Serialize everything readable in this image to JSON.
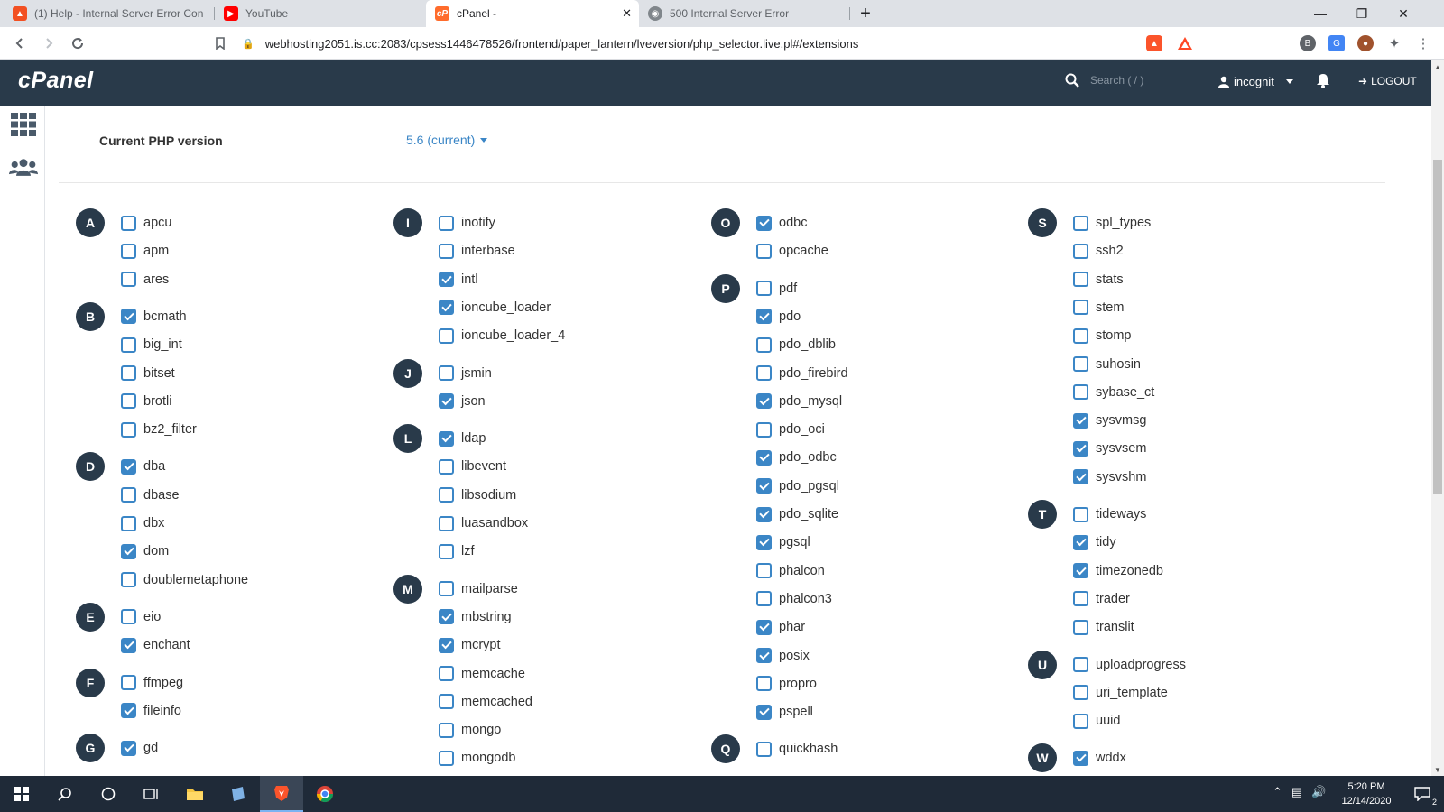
{
  "browser": {
    "tabs": [
      {
        "label": "(1) Help - Internal Server Error Conne",
        "icon": "brave-lion-icon",
        "active": false
      },
      {
        "label": "YouTube",
        "icon": "youtube-icon",
        "active": false
      },
      {
        "label": "cPanel -",
        "icon": "cpanel-icon",
        "active": true
      },
      {
        "label": "500 Internal Server Error",
        "icon": "globe-icon",
        "active": false
      }
    ],
    "new_tab_label": "+",
    "url": "webhosting2051.is.cc:2083/cpsess1446478526/frontend/paper_lantern/lveversion/php_selector.live.pl#/extensions"
  },
  "cpanel": {
    "logo": "cPanel",
    "search_placeholder": "Search ( / )",
    "user": "incognit",
    "logout": "LOGOUT",
    "brand_color": "#293a4a",
    "accent_color": "#3b86c6"
  },
  "php": {
    "label": "Current PHP version",
    "version": "5.6 (current)"
  },
  "extension_columns": [
    [
      {
        "letter": "A",
        "items": [
          {
            "name": "apcu",
            "checked": false
          },
          {
            "name": "apm",
            "checked": false
          },
          {
            "name": "ares",
            "checked": false
          }
        ]
      },
      {
        "letter": "B",
        "items": [
          {
            "name": "bcmath",
            "checked": true
          },
          {
            "name": "big_int",
            "checked": false
          },
          {
            "name": "bitset",
            "checked": false
          },
          {
            "name": "brotli",
            "checked": false
          },
          {
            "name": "bz2_filter",
            "checked": false
          }
        ]
      },
      {
        "letter": "D",
        "items": [
          {
            "name": "dba",
            "checked": true
          },
          {
            "name": "dbase",
            "checked": false
          },
          {
            "name": "dbx",
            "checked": false
          },
          {
            "name": "dom",
            "checked": true
          },
          {
            "name": "doublemetaphone",
            "checked": false
          }
        ]
      },
      {
        "letter": "E",
        "items": [
          {
            "name": "eio",
            "checked": false
          },
          {
            "name": "enchant",
            "checked": true
          }
        ]
      },
      {
        "letter": "F",
        "items": [
          {
            "name": "ffmpeg",
            "checked": false
          },
          {
            "name": "fileinfo",
            "checked": true
          }
        ]
      },
      {
        "letter": "G",
        "items": [
          {
            "name": "gd",
            "checked": true
          }
        ]
      }
    ],
    [
      {
        "letter": "I",
        "items": [
          {
            "name": "inotify",
            "checked": false
          },
          {
            "name": "interbase",
            "checked": false
          },
          {
            "name": "intl",
            "checked": true
          },
          {
            "name": "ioncube_loader",
            "checked": true
          },
          {
            "name": "ioncube_loader_4",
            "checked": false
          }
        ]
      },
      {
        "letter": "J",
        "items": [
          {
            "name": "jsmin",
            "checked": false
          },
          {
            "name": "json",
            "checked": true
          }
        ]
      },
      {
        "letter": "L",
        "items": [
          {
            "name": "ldap",
            "checked": true
          },
          {
            "name": "libevent",
            "checked": false
          },
          {
            "name": "libsodium",
            "checked": false
          },
          {
            "name": "luasandbox",
            "checked": false
          },
          {
            "name": "lzf",
            "checked": false
          }
        ]
      },
      {
        "letter": "M",
        "items": [
          {
            "name": "mailparse",
            "checked": false
          },
          {
            "name": "mbstring",
            "checked": true
          },
          {
            "name": "mcrypt",
            "checked": true
          },
          {
            "name": "memcache",
            "checked": false
          },
          {
            "name": "memcached",
            "checked": false
          },
          {
            "name": "mongo",
            "checked": false
          },
          {
            "name": "mongodb",
            "checked": false
          }
        ]
      }
    ],
    [
      {
        "letter": "O",
        "items": [
          {
            "name": "odbc",
            "checked": true
          },
          {
            "name": "opcache",
            "checked": false
          }
        ]
      },
      {
        "letter": "P",
        "items": [
          {
            "name": "pdf",
            "checked": false
          },
          {
            "name": "pdo",
            "checked": true
          },
          {
            "name": "pdo_dblib",
            "checked": false
          },
          {
            "name": "pdo_firebird",
            "checked": false
          },
          {
            "name": "pdo_mysql",
            "checked": true
          },
          {
            "name": "pdo_oci",
            "checked": false
          },
          {
            "name": "pdo_odbc",
            "checked": true
          },
          {
            "name": "pdo_pgsql",
            "checked": true
          },
          {
            "name": "pdo_sqlite",
            "checked": true
          },
          {
            "name": "pgsql",
            "checked": true
          },
          {
            "name": "phalcon",
            "checked": false
          },
          {
            "name": "phalcon3",
            "checked": false
          },
          {
            "name": "phar",
            "checked": true
          },
          {
            "name": "posix",
            "checked": true
          },
          {
            "name": "propro",
            "checked": false
          },
          {
            "name": "pspell",
            "checked": true
          }
        ]
      },
      {
        "letter": "Q",
        "items": [
          {
            "name": "quickhash",
            "checked": false
          }
        ]
      }
    ],
    [
      {
        "letter": "S",
        "items": [
          {
            "name": "spl_types",
            "checked": false
          },
          {
            "name": "ssh2",
            "checked": false
          },
          {
            "name": "stats",
            "checked": false
          },
          {
            "name": "stem",
            "checked": false
          },
          {
            "name": "stomp",
            "checked": false
          },
          {
            "name": "suhosin",
            "checked": false
          },
          {
            "name": "sybase_ct",
            "checked": false
          },
          {
            "name": "sysvmsg",
            "checked": true
          },
          {
            "name": "sysvsem",
            "checked": true
          },
          {
            "name": "sysvshm",
            "checked": true
          }
        ]
      },
      {
        "letter": "T",
        "items": [
          {
            "name": "tideways",
            "checked": false
          },
          {
            "name": "tidy",
            "checked": true
          },
          {
            "name": "timezonedb",
            "checked": true
          },
          {
            "name": "trader",
            "checked": false
          },
          {
            "name": "translit",
            "checked": false
          }
        ]
      },
      {
        "letter": "U",
        "items": [
          {
            "name": "uploadprogress",
            "checked": false
          },
          {
            "name": "uri_template",
            "checked": false
          },
          {
            "name": "uuid",
            "checked": false
          }
        ]
      },
      {
        "letter": "W",
        "items": [
          {
            "name": "wddx",
            "checked": true
          }
        ]
      }
    ]
  ],
  "taskbar": {
    "time": "5:20 PM",
    "date": "12/14/2020",
    "notification_count": "2"
  }
}
